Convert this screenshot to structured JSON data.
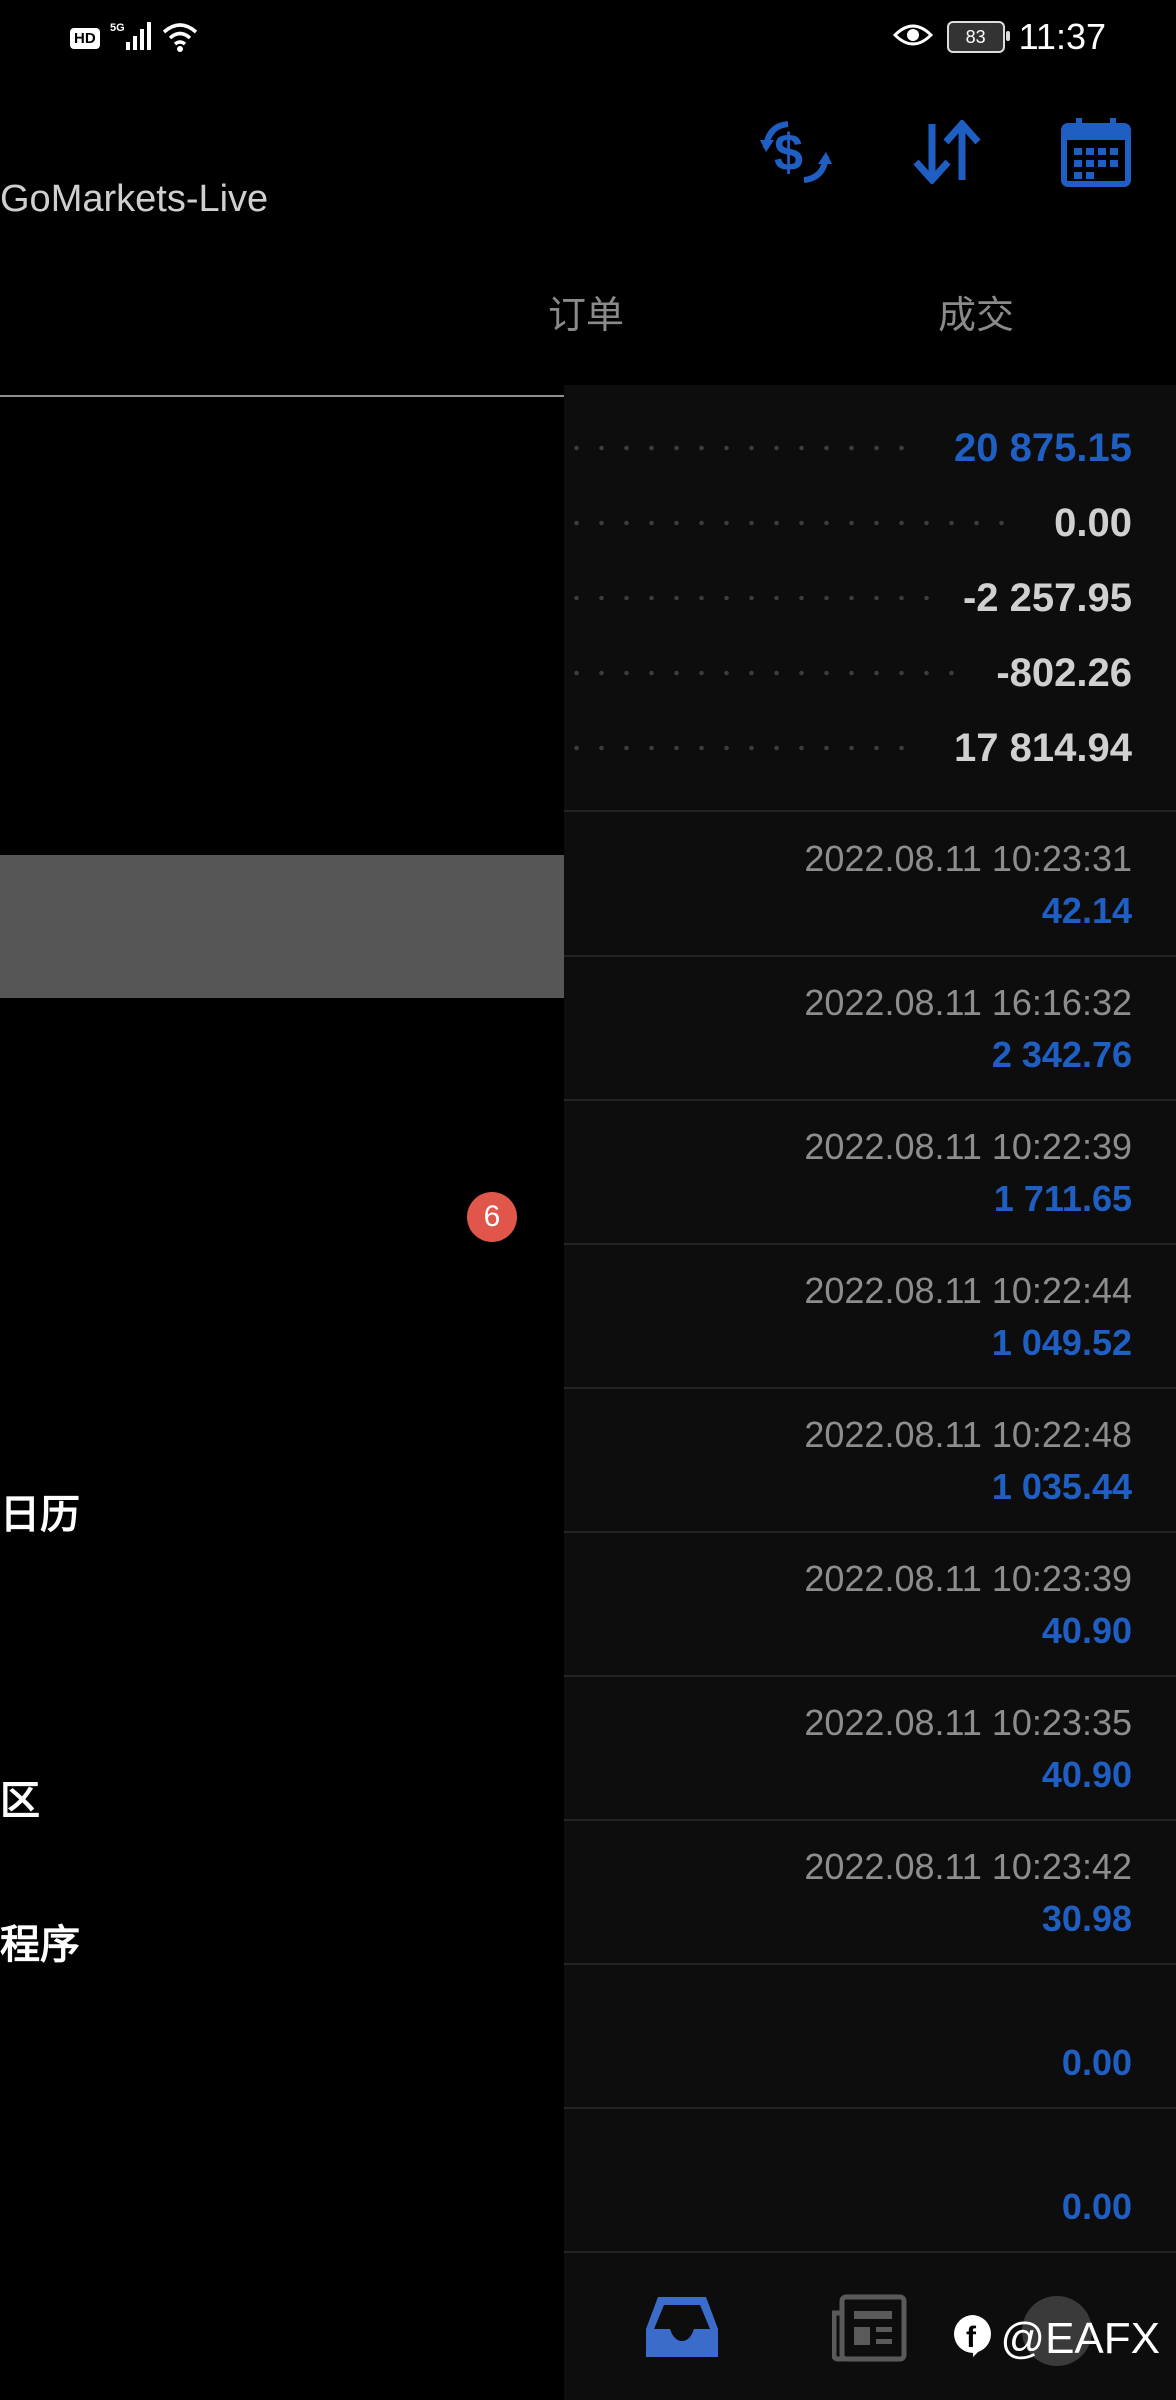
{
  "status_bar": {
    "hd": "HD",
    "network": "5G",
    "battery": "83",
    "time": "11:37"
  },
  "header": {
    "server_name": "GoMarkets-Live",
    "icons": [
      "currency-exchange-icon",
      "sort-icon",
      "calendar-icon"
    ],
    "accent_color": "#1f5fc4"
  },
  "tabs": [
    "订单",
    "成交"
  ],
  "drawer": {
    "badge": "6",
    "items": [
      "日历",
      "区",
      "程序"
    ]
  },
  "summary": [
    {
      "value": "20 875.15",
      "highlight": true
    },
    {
      "value": "0.00",
      "highlight": false
    },
    {
      "value": "-2 257.95",
      "highlight": false
    },
    {
      "value": "-802.26",
      "highlight": false
    },
    {
      "value": "17 814.94",
      "highlight": false
    }
  ],
  "deals": [
    {
      "time": "2022.08.11 10:23:31",
      "value": "42.14"
    },
    {
      "time": "2022.08.11 16:16:32",
      "value": "2 342.76"
    },
    {
      "time": "2022.08.11 10:22:39",
      "value": "1 711.65"
    },
    {
      "time": "2022.08.11 10:22:44",
      "value": "1 049.52"
    },
    {
      "time": "2022.08.11 10:22:48",
      "value": "1 035.44"
    },
    {
      "time": "2022.08.11 10:23:39",
      "value": "40.90"
    },
    {
      "time": "2022.08.11 10:23:35",
      "value": "40.90"
    },
    {
      "time": "2022.08.11 10:23:42",
      "value": "30.98"
    },
    {
      "time": "",
      "value": "0.00"
    },
    {
      "time": "",
      "value": "0.00"
    }
  ],
  "bottom_nav": {
    "icons": [
      "inbox-icon",
      "news-icon"
    ],
    "watermark": "@EAFX"
  }
}
